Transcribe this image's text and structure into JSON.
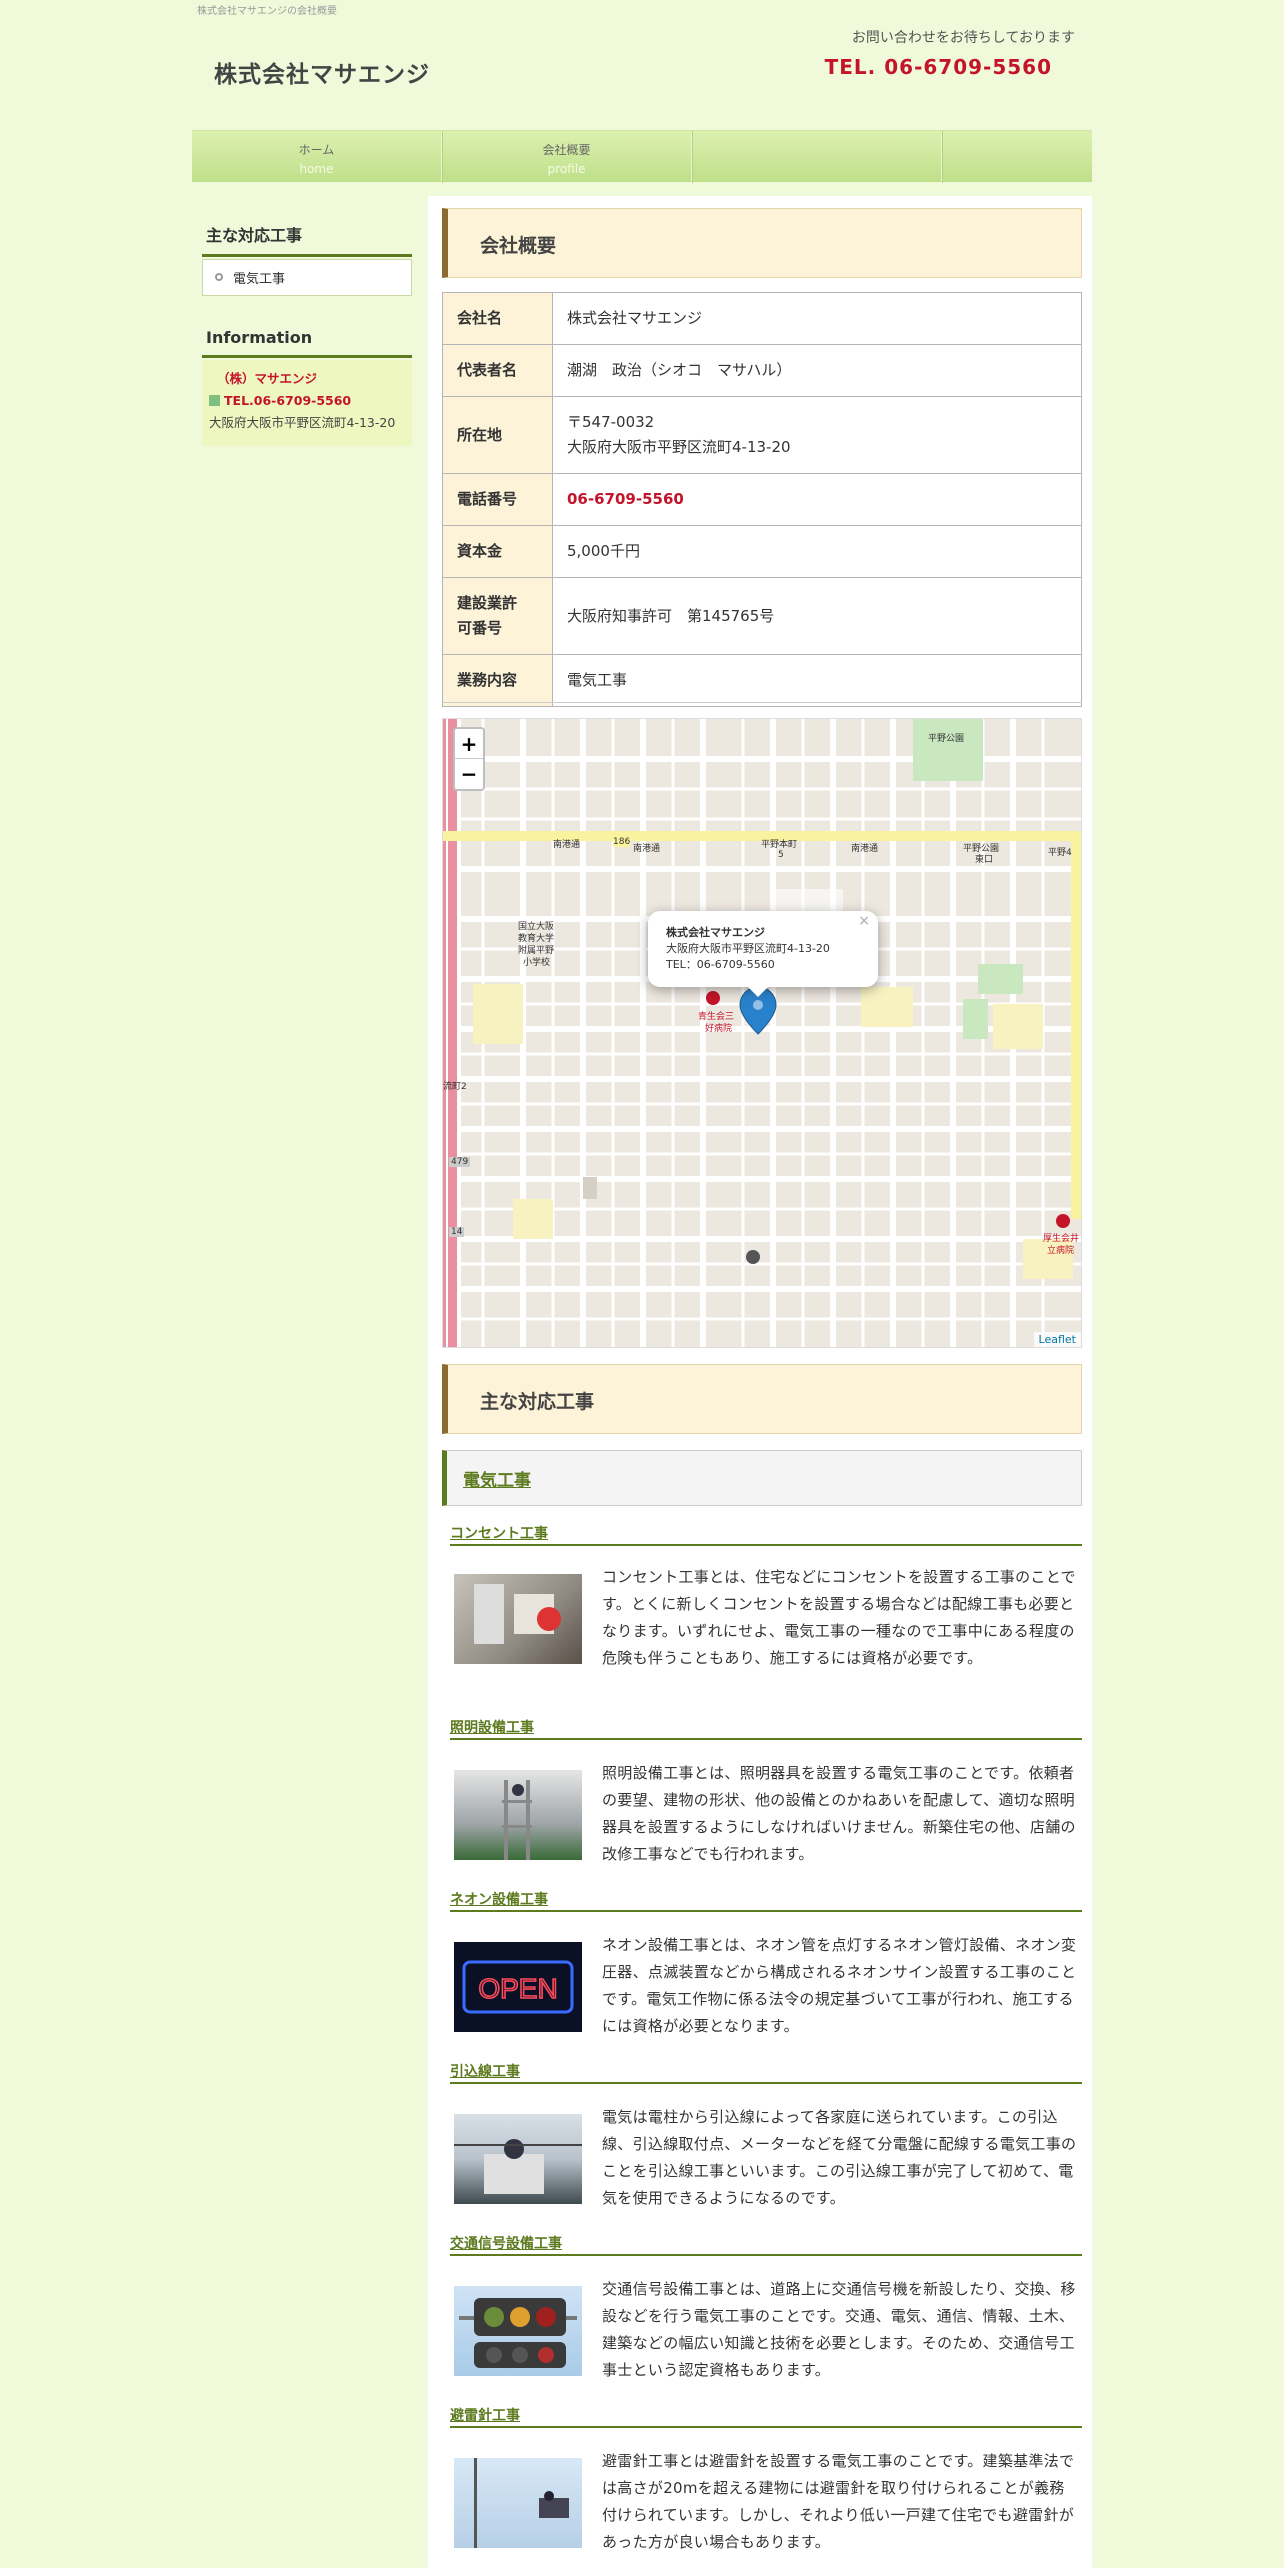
{
  "topline": "株式会社マサエンジの会社概要",
  "header": {
    "site_title": "株式会社マサエンジ",
    "contact_message": "お問い合わせをお待ちしております",
    "tel": "TEL. 06-6709-5560"
  },
  "nav": [
    {
      "label": "ホーム",
      "sub": "home"
    },
    {
      "label": "会社概要",
      "sub": "profile"
    }
  ],
  "sidebar": {
    "works_heading": "主な対応工事",
    "works_items": [
      "電気工事"
    ],
    "info_heading": "Information",
    "info_name": "（株）マサエンジ",
    "info_tel": "TEL.06-6709-5560",
    "info_address": "大阪府大阪市平野区流町4-13-20"
  },
  "main": {
    "company_heading": "会社概要",
    "company_table": [
      {
        "label": "会社名",
        "value": "株式会社マサエンジ"
      },
      {
        "label": "代表者名",
        "value": "潮湖　政治（シオコ　マサハル）"
      },
      {
        "label": "所在地",
        "value": "〒547-0032\n大阪府大阪市平野区流町4-13-20"
      },
      {
        "label": "電話番号",
        "value": "06-6709-5560"
      },
      {
        "label": "資本金",
        "value": "5,000千円"
      },
      {
        "label": "建設業許可番号",
        "value": "大阪府知事許可　第145765号"
      },
      {
        "label": "業務内容",
        "value": "電気工事"
      }
    ],
    "map": {
      "zoom_in": "+",
      "zoom_out": "−",
      "popup_title": "株式会社マサエンジ",
      "popup_address": "大阪府大阪市平野区流町4-13-20",
      "popup_tel": "TEL：06-6709-5560",
      "popup_close": "×",
      "attribution": "Leaflet",
      "labels": [
        "平野公園",
        "南港通",
        "186",
        "南港通",
        "平野本町",
        "5",
        "南港通",
        "平野公園",
        "東口",
        "平野4",
        "国立大阪",
        "教育大学",
        "附属平野",
        "小学校",
        "青生会三",
        "好病院",
        "479",
        "14",
        "厚生会井",
        "立病院",
        "流町2"
      ]
    },
    "works_heading": "主な対応工事",
    "category": "電気工事",
    "services": [
      {
        "title": "コンセント工事",
        "text": "コンセント工事とは、住宅などにコンセントを設置する工事のことです。とくに新しくコンセントを設置する場合などは配線工事も必要となります。いずれにせよ、電気工事の一種なので工事中にある程度の危険も伴うこともあり、施工するには資格が必要です。"
      },
      {
        "title": "照明設備工事",
        "text": "照明設備工事とは、照明器具を設置する電気工事のことです。依頼者の要望、建物の形状、他の設備とのかねあいを配慮して、適切な照明器具を設置するようにしなければいけません。新築住宅の他、店舗の改修工事などでも行われます。"
      },
      {
        "title": "ネオン設備工事",
        "text": "ネオン設備工事とは、ネオン管を点灯するネオン管灯設備、ネオン変圧器、点滅装置などから構成されるネオンサイン設置する工事のことです。電気工作物に係る法令の規定基づいて工事が行われ、施工するには資格が必要となります。"
      },
      {
        "title": "引込線工事",
        "text": "電気は電柱から引込線によって各家庭に送られています。この引込線、引込線取付点、メーターなどを経て分電盤に配線する電気工事のことを引込線工事といいます。この引込線工事が完了して初めて、電気を使用できるようになるのです。"
      },
      {
        "title": "交通信号設備工事",
        "text": "交通信号設備工事とは、道路上に交通信号機を新設したり、交換、移設などを行う電気工事のことです。交通、電気、通信、情報、土木、建築などの幅広い知識と技術を必要とします。そのため、交通信号工事士という認定資格もあります。"
      },
      {
        "title": "避雷針工事",
        "text": "避雷針工事とは避雷針を設置する電気工事のことです。建築基準法では高さが20mを超える建物には避雷針を取り付けられることが義務付けられています。しかし、それより低い一戸建て住宅でも避雷針があった方が良い場合もあります。"
      }
    ],
    "neon_sign_text": "OPEN"
  }
}
